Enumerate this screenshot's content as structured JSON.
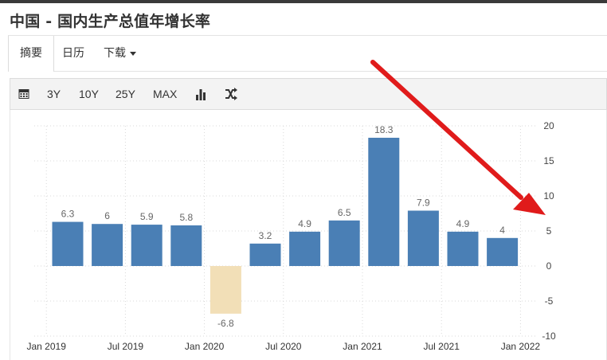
{
  "page": {
    "title": "中国 - 国内生产总值年增长率"
  },
  "tabs": [
    {
      "label": "摘要",
      "active": true
    },
    {
      "label": "日历",
      "active": false
    },
    {
      "label": "下载",
      "active": false,
      "has_dropdown": true
    }
  ],
  "toolbar": {
    "calendar_icon": "calendar-icon",
    "ranges": [
      "3Y",
      "10Y",
      "25Y",
      "MAX"
    ],
    "bar_chart_icon": "bar-chart-icon",
    "compare_icon": "shuffle-icon"
  },
  "colors": {
    "positive_bar": "#4a7fb5",
    "negative_bar": "#f2dfb7",
    "annotation_arrow": "#e01b1b",
    "grid": "#d9d9d9"
  },
  "chart_data": {
    "type": "bar",
    "categories": [
      "2019 Q1",
      "2019 Q2",
      "2019 Q3",
      "2019 Q4",
      "2020 Q1",
      "2020 Q2",
      "2020 Q3",
      "2020 Q4",
      "2021 Q1",
      "2021 Q2",
      "2021 Q3",
      "2021 Q4"
    ],
    "values": [
      6.3,
      6,
      5.9,
      5.8,
      -6.8,
      3.2,
      4.9,
      6.5,
      18.3,
      7.9,
      4.9,
      4
    ],
    "value_labels": [
      "6.3",
      "6",
      "5.9",
      "5.8",
      "-6.8",
      "3.2",
      "4.9",
      "6.5",
      "18.3",
      "7.9",
      "4.9",
      "4"
    ],
    "x_tick_labels": [
      "Jan 2019",
      "Jul 2019",
      "Jan 2020",
      "Jul 2020",
      "Jan 2021",
      "Jul 2021",
      "Jan 2022"
    ],
    "y_ticks": [
      "20",
      "15",
      "10",
      "5",
      "0",
      "-5",
      "-10"
    ],
    "ylim": [
      -10,
      20
    ],
    "y_axis_side": "right",
    "grid": true,
    "annotation": "red arrow pointing to the right-hand y-axis near 5"
  }
}
